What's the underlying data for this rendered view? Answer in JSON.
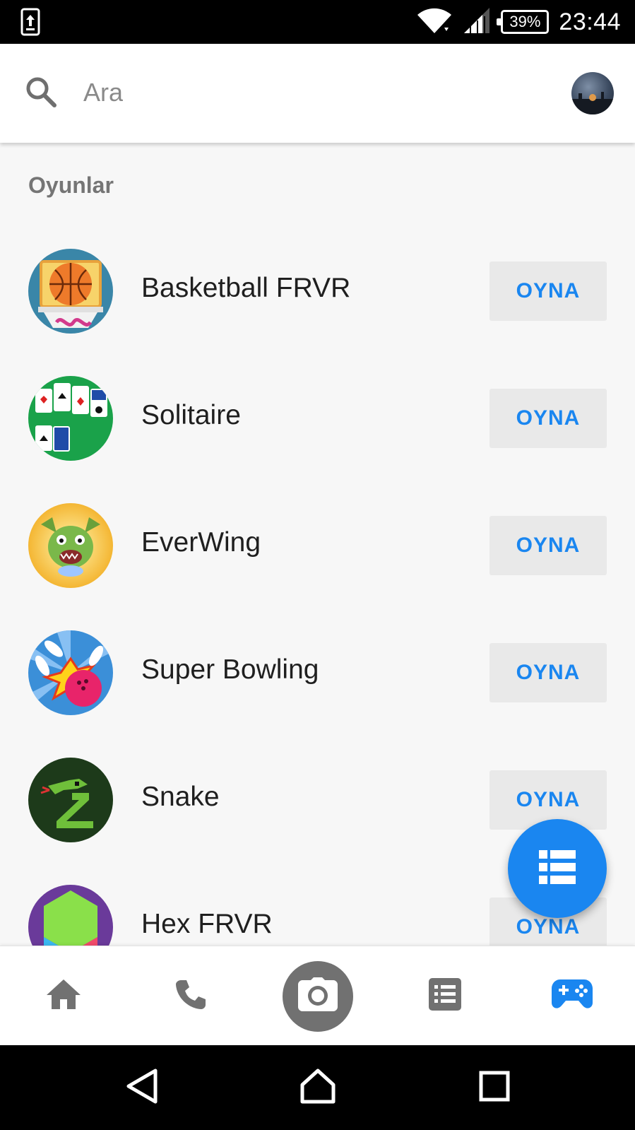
{
  "status_bar": {
    "battery": "39%",
    "time": "23:44"
  },
  "search": {
    "placeholder": "Ara"
  },
  "section": {
    "title": "Oyunlar"
  },
  "games": [
    {
      "name": "Basketball FRVR",
      "button": "OYNA"
    },
    {
      "name": "Solitaire",
      "button": "OYNA"
    },
    {
      "name": "EverWing",
      "button": "OYNA"
    },
    {
      "name": "Super Bowling",
      "button": "OYNA"
    },
    {
      "name": "Snake",
      "button": "OYNA"
    },
    {
      "name": "Hex FRVR",
      "button": "OYNA"
    }
  ],
  "tabs": [
    {
      "icon": "home-icon",
      "active": false
    },
    {
      "icon": "phone-icon",
      "active": false
    },
    {
      "icon": "camera-icon",
      "active": false
    },
    {
      "icon": "list-icon",
      "active": false
    },
    {
      "icon": "gamepad-icon",
      "active": true
    }
  ],
  "colors": {
    "accent": "#1a86f0",
    "tab_inactive": "#717171"
  }
}
